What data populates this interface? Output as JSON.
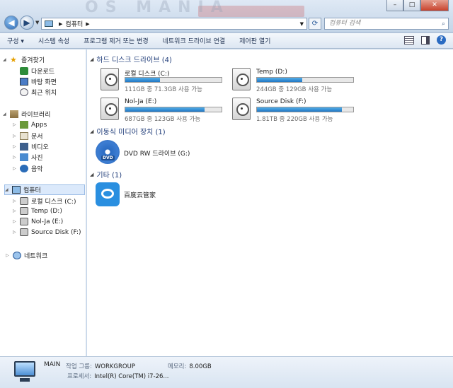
{
  "window": {
    "bg_text": "OS MANIA",
    "minimize": "–",
    "maximize": "□",
    "close": "✕"
  },
  "address": {
    "crumb": "컴퓨터",
    "search_placeholder": "컴퓨터 검색"
  },
  "toolbar": {
    "items": [
      "구성 ▾",
      "시스템 속성",
      "프로그램 제거 또는 변경",
      "네트워크 드라이브 연결",
      "제어판 열기"
    ]
  },
  "sidebar": {
    "favorites": {
      "label": "즐겨찾기",
      "items": [
        "다운로드",
        "바탕 화면",
        "최근 위치"
      ]
    },
    "libraries": {
      "label": "라이브러리",
      "items": [
        "Apps",
        "문서",
        "비디오",
        "사진",
        "음악"
      ]
    },
    "computer": {
      "label": "컴퓨터",
      "items": [
        "로컬 디스크 (C:)",
        "Temp (D:)",
        "Nol-Ja (E:)",
        "Source Disk (F:)"
      ]
    },
    "network": {
      "label": "네트워크"
    }
  },
  "groups": {
    "hdd": "하드 디스크 드라이브 (4)",
    "removable": "이동식 미디어 장치 (1)",
    "other": "기타 (1)"
  },
  "drives": [
    {
      "name": "로컬 디스크 (C:)",
      "free": "111GB 중 71.3GB 사용 가능",
      "used_fraction": 0.36
    },
    {
      "name": "Temp (D:)",
      "free": "244GB 중 129GB 사용 가능",
      "used_fraction": 0.47
    },
    {
      "name": "Nol-Ja (E:)",
      "free": "687GB 중 123GB 사용 가능",
      "used_fraction": 0.82
    },
    {
      "name": "Source Disk (F:)",
      "free": "1.81TB 중 220GB 사용 가능",
      "used_fraction": 0.88
    }
  ],
  "dvd": {
    "name": "DVD RW 드라이브 (G:)",
    "badge": "DVD"
  },
  "other_item": {
    "name": "百度云管家"
  },
  "details": {
    "name": "MAIN",
    "workgroup_label": "작업 그룹:",
    "workgroup": "WORKGROUP",
    "memory_label": "메모리:",
    "memory": "8.00GB",
    "cpu_label": "프로세서:",
    "cpu": "Intel(R) Core(TM) i7-26..."
  },
  "colors": {
    "accent": "#2278c4",
    "group_heading": "#1e3b78",
    "selection": "#dbe9fb"
  }
}
